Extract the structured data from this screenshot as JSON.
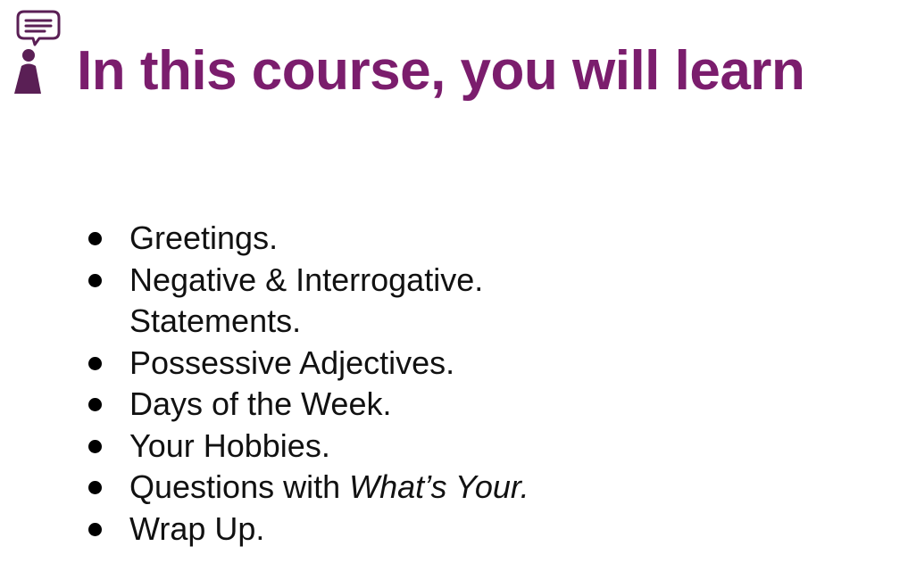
{
  "slide": {
    "title": "In this course, you will learn",
    "logo_icon": "person-speech-bubble-icon",
    "colors": {
      "title": "#7b1d6d",
      "icon": "#5a1f55",
      "text": "#111111"
    }
  },
  "topics": [
    {
      "text": "Greetings."
    },
    {
      "text": "Negative & Interrogative.",
      "continuation": "Statements."
    },
    {
      "text": "Possessive Adjectives."
    },
    {
      "text": "Days of the Week."
    },
    {
      "text": "Your Hobbies."
    },
    {
      "text": "Questions with ",
      "emphasis": "What’s Your."
    },
    {
      "text": "Wrap Up."
    }
  ]
}
